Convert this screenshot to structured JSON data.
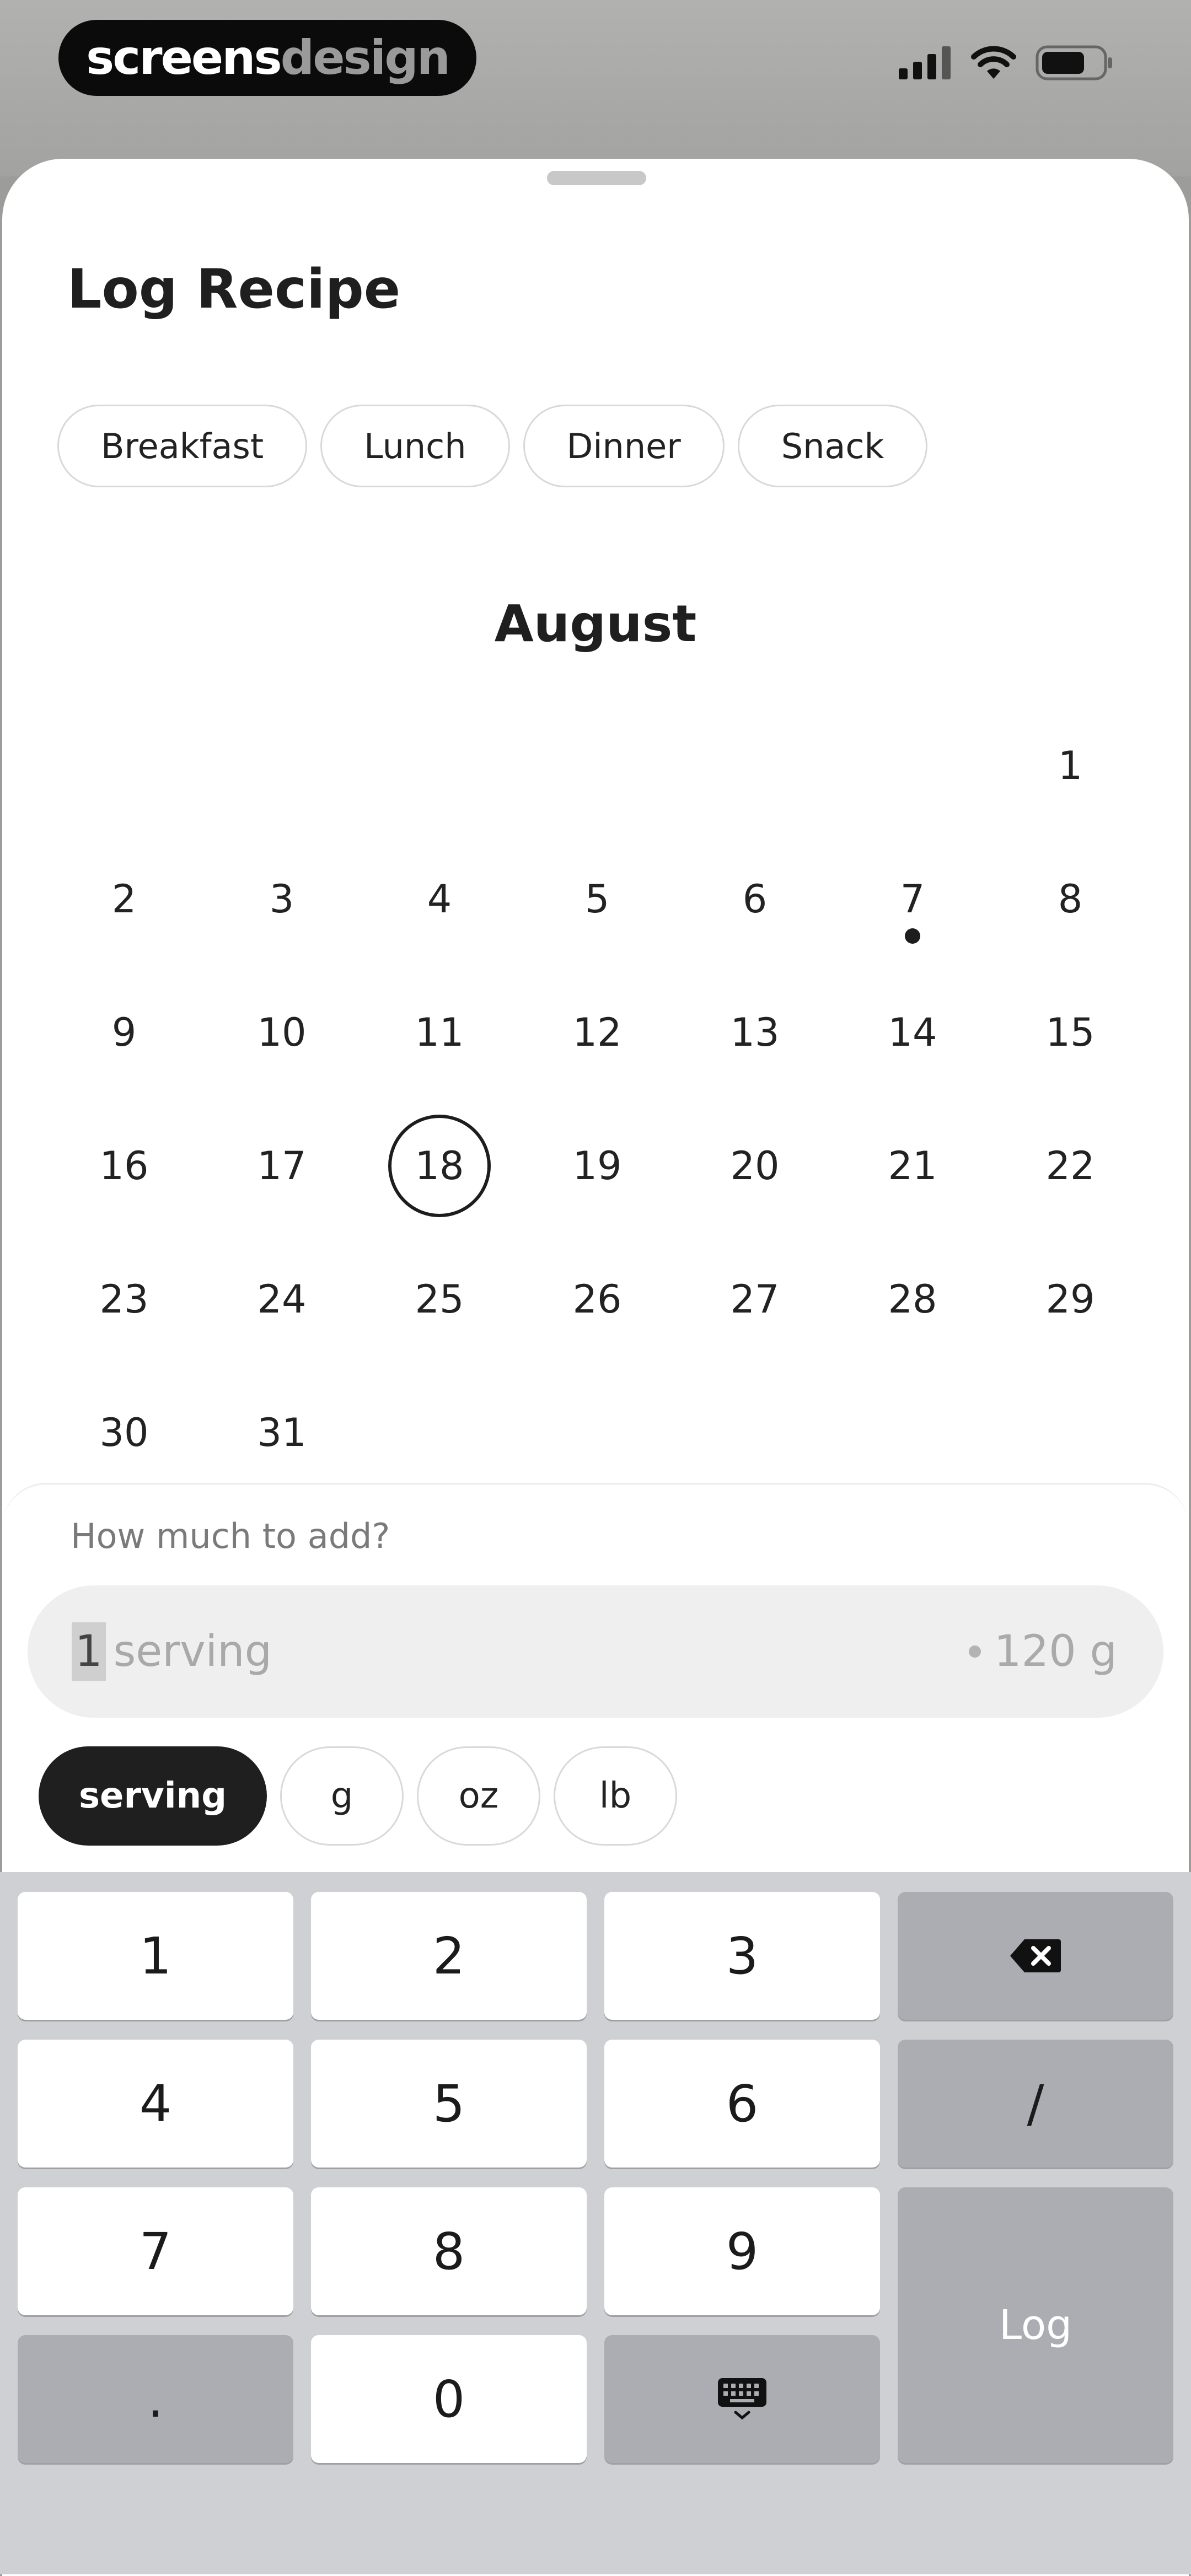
{
  "brand": {
    "part1": "screens",
    "part2": "design"
  },
  "title": "Log Recipe",
  "meal_tabs": [
    "Breakfast",
    "Lunch",
    "Dinner",
    "Snack"
  ],
  "calendar": {
    "month": "August",
    "rows": [
      [
        "",
        "",
        "",
        "",
        "",
        "",
        "1"
      ],
      [
        "2",
        "3",
        "4",
        "5",
        "6",
        "7",
        "8"
      ],
      [
        "9",
        "10",
        "11",
        "12",
        "13",
        "14",
        "15"
      ],
      [
        "16",
        "17",
        "18",
        "19",
        "20",
        "21",
        "22"
      ],
      [
        "23",
        "24",
        "25",
        "26",
        "27",
        "28",
        "29"
      ],
      [
        "30",
        "31",
        "",
        "",
        "",
        "",
        ""
      ]
    ],
    "selected_day": "18",
    "marked_days": [
      "7"
    ]
  },
  "amount": {
    "prompt": "How much to add?",
    "value": "1",
    "unit_label": "serving",
    "weight": "120 g"
  },
  "units": [
    "serving",
    "g",
    "oz",
    "lb"
  ],
  "selected_unit": "serving",
  "keypad": {
    "k1": "1",
    "k2": "2",
    "k3": "3",
    "k4": "4",
    "k5": "5",
    "k6": "6",
    "k7": "7",
    "k8": "8",
    "k9": "9",
    "kdot": ".",
    "k0": "0",
    "slash": "/",
    "log": "Log"
  },
  "colors": {
    "accent": "#1f1f1f",
    "keyboard_bg": "#cfd0d4"
  },
  "icons": {
    "backspace": "backspace-icon",
    "keyboard": "keyboard-icon",
    "signal": "signal-icon",
    "wifi": "wifi-icon",
    "battery": "battery-icon"
  }
}
